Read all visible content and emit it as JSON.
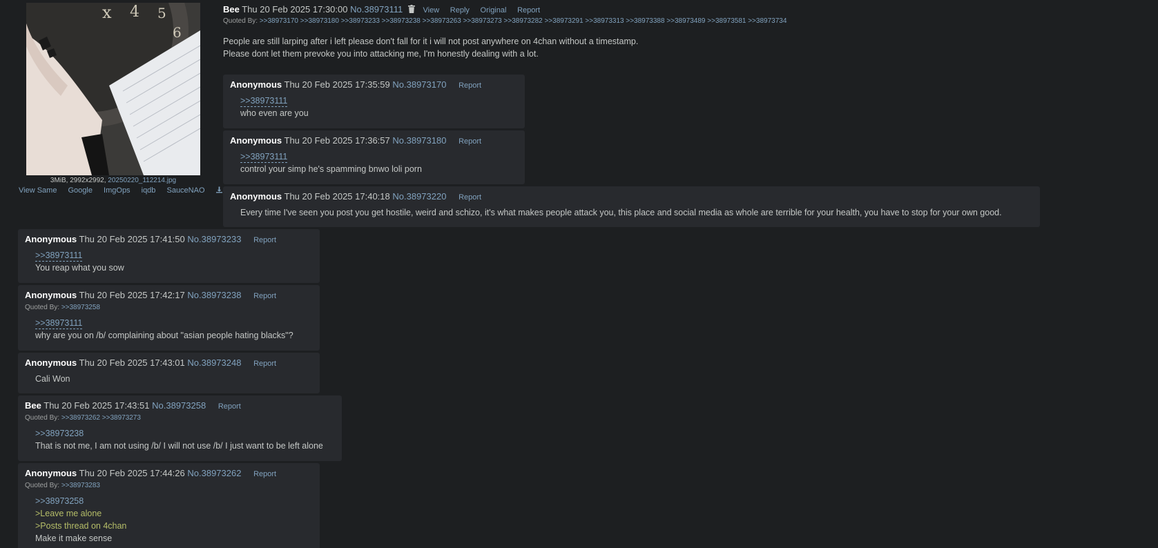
{
  "op": {
    "name": "Bee",
    "datetime": "Thu 20 Feb 2025 17:30:00",
    "no": "No.38973111",
    "controls": [
      "View",
      "Reply",
      "Original",
      "Report"
    ],
    "quoted_by_label": "Quoted By:",
    "quoted_by": ">>38973170 >>38973180 >>38973233 >>38973238 >>38973263 >>38973273 >>38973282 >>38973291 >>38973313 >>38973388 >>38973489 >>38973581 >>38973734",
    "body": [
      "People are still larping after i left please don't fall for it i will not post anywhere on 4chan without a timestamp.",
      "Please dont let them prevoke you into attacking me, I'm honestly dealing with a lot."
    ],
    "file": {
      "meta": "3MiB, 2992x2992,",
      "filename": "20250220_112214.jpg"
    },
    "image_links": [
      "View Same",
      "Google",
      "ImgOps",
      "iqdb",
      "SauceNAO"
    ],
    "icons": {
      "delete": "trash-icon",
      "download": "download-icon"
    }
  },
  "report_label": "Report",
  "quoted_by_label": "Quoted By:",
  "replies": [
    {
      "name": "Anonymous",
      "datetime": "Thu 20 Feb 2025 17:35:59",
      "no": "No.38973170",
      "quote": ">>38973111",
      "lines": [
        "who even are you"
      ]
    },
    {
      "name": "Anonymous",
      "datetime": "Thu 20 Feb 2025 17:36:57",
      "no": "No.38973180",
      "quote": ">>38973111",
      "lines": [
        "control your simp he's spamming bnwo loli porn"
      ]
    },
    {
      "name": "Anonymous",
      "datetime": "Thu 20 Feb 2025 17:40:18",
      "no": "No.38973220",
      "lines": [
        "Every time I've seen you post you get hostile, weird and schizo, it's what makes people attack you, this place and social media as whole are terrible for your health, you have to stop for your own good."
      ]
    },
    {
      "name": "Anonymous",
      "datetime": "Thu 20 Feb 2025 17:41:50",
      "no": "No.38973233",
      "quote": ">>38973111",
      "lines": [
        "You reap what you sow"
      ]
    },
    {
      "name": "Anonymous",
      "datetime": "Thu 20 Feb 2025 17:42:17",
      "no": "No.38973238",
      "quoted_by": ">>38973258",
      "quote": ">>38973111",
      "lines": [
        "why are you on /b/ complaining about \"asian people hating blacks\"?"
      ]
    },
    {
      "name": "Anonymous",
      "datetime": "Thu 20 Feb 2025 17:43:01",
      "no": "No.38973248",
      "lines": [
        "Cali Won"
      ]
    },
    {
      "name": "Bee",
      "datetime": "Thu 20 Feb 2025 17:43:51",
      "no": "No.38973258",
      "quoted_by": ">>38973262 >>38973273",
      "quote": ">>38973238",
      "lines": [
        "That is not me, I am not using /b/ I will not use /b/ I just want to be left alone"
      ]
    },
    {
      "name": "Anonymous",
      "datetime": "Thu 20 Feb 2025 17:44:26",
      "no": "No.38973262",
      "quoted_by": ">>38973283",
      "quote": ">>38973258",
      "greentext": [
        ">Leave me alone",
        ">Posts thread on 4chan"
      ],
      "lines": [
        "Make it make sense"
      ]
    }
  ],
  "colors": {
    "background": "#1d1f21",
    "post_bg": "#282a2e",
    "link": "#81a2be",
    "text": "#c5c8c6",
    "greentext": "#b5bd68"
  }
}
